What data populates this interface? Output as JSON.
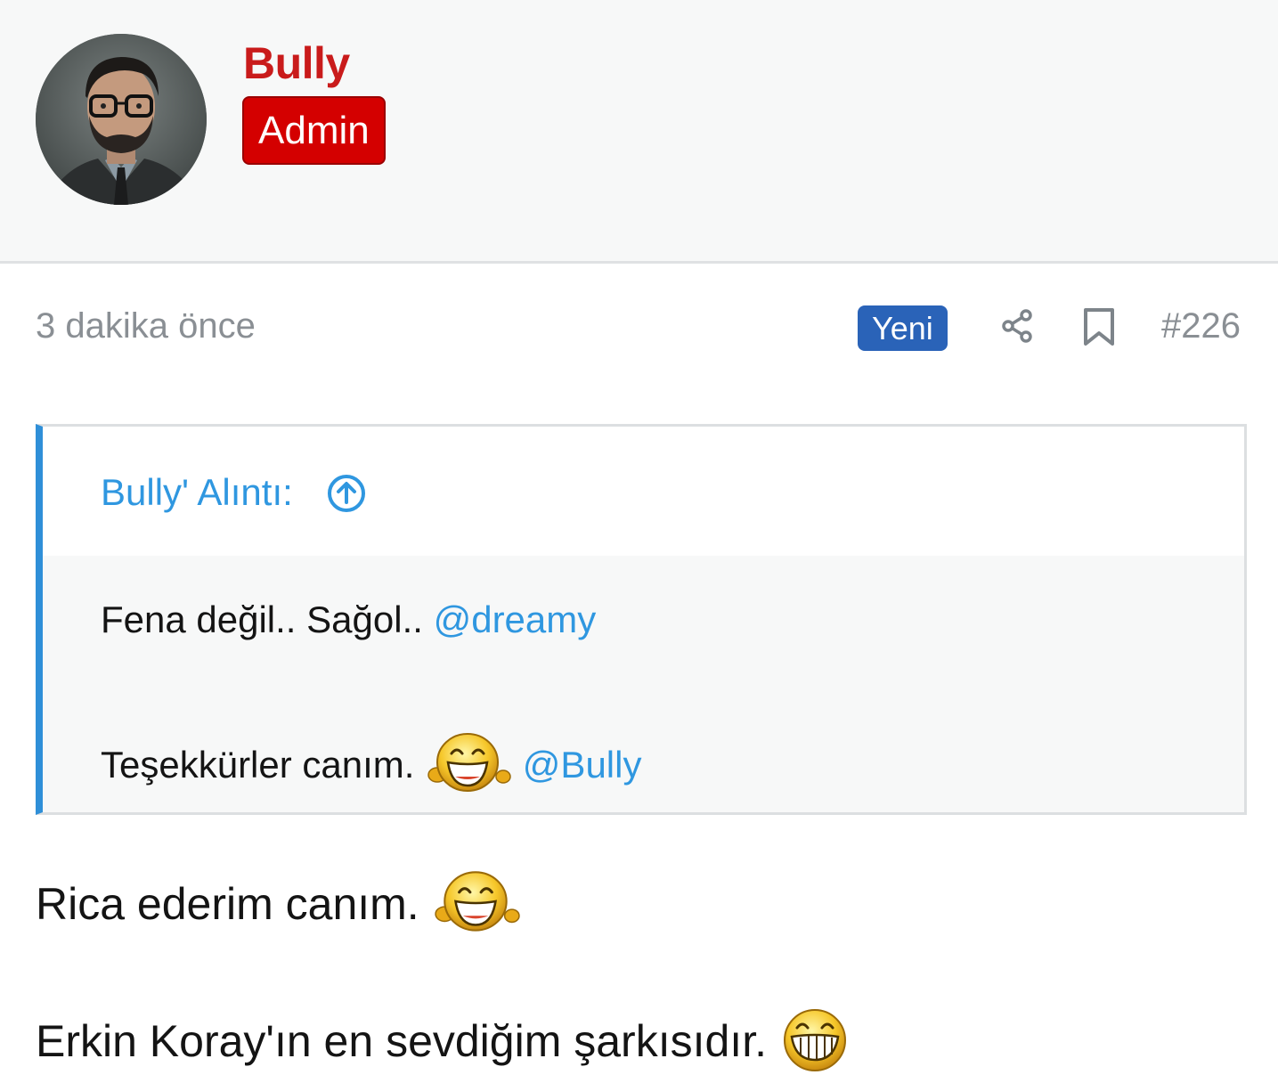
{
  "author": {
    "name": "Bully",
    "role": "Admin",
    "name_color": "#c91b1b",
    "role_badge_color": "#d40000"
  },
  "post": {
    "time": "3 dakika önce",
    "new_badge": "Yeni",
    "number": "#226",
    "icons": [
      "share-icon",
      "bookmark-icon"
    ]
  },
  "quote": {
    "header": "Bully' Alıntı:",
    "header_icon": "arrow-up-circle-icon",
    "line1_text": "Fena değil.. Sağol..",
    "line1_mention": "@dreamy",
    "line2_text": "Teşekkürler canım.",
    "line2_smiley": "laughing-smiley-icon",
    "line2_mention": "@Bully",
    "accent_color": "#2f8fd8"
  },
  "body": {
    "line1_text": "Rica ederim canım.",
    "line1_smiley": "laughing-smiley-icon",
    "line2_text": "Erkin Koray'ın en sevdiğim şarkısıdır.",
    "line2_smiley": "grinning-smiley-icon"
  }
}
